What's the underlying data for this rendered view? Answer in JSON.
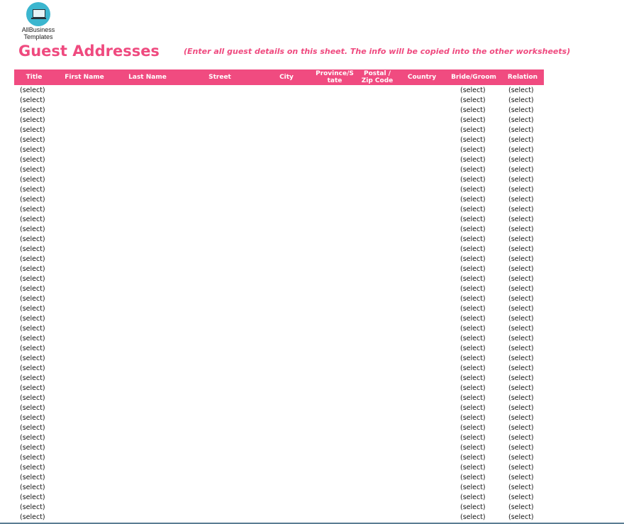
{
  "logo": {
    "line1": "AllBusiness",
    "line2": "Templates",
    "icon": "laptop-icon"
  },
  "page_title": "Guest Addresses",
  "instruction": "(Enter all guest details on this sheet. The info will be copied into the other worksheets)",
  "colors": {
    "accent": "#f04b80",
    "title": "#ef4a7f"
  },
  "table": {
    "columns": [
      {
        "key": "title",
        "label": "Title"
      },
      {
        "key": "first_name",
        "label": "First Name"
      },
      {
        "key": "last_name",
        "label": "Last Name"
      },
      {
        "key": "street",
        "label": "Street"
      },
      {
        "key": "city",
        "label": "City"
      },
      {
        "key": "province",
        "label": "Province/S tate"
      },
      {
        "key": "postal",
        "label": "Postal / Zip Code"
      },
      {
        "key": "country",
        "label": "Country"
      },
      {
        "key": "bride_groom",
        "label": "Bride/Groom"
      },
      {
        "key": "relation",
        "label": "Relation"
      }
    ],
    "row_count": 44,
    "default_cell": "(select)"
  }
}
